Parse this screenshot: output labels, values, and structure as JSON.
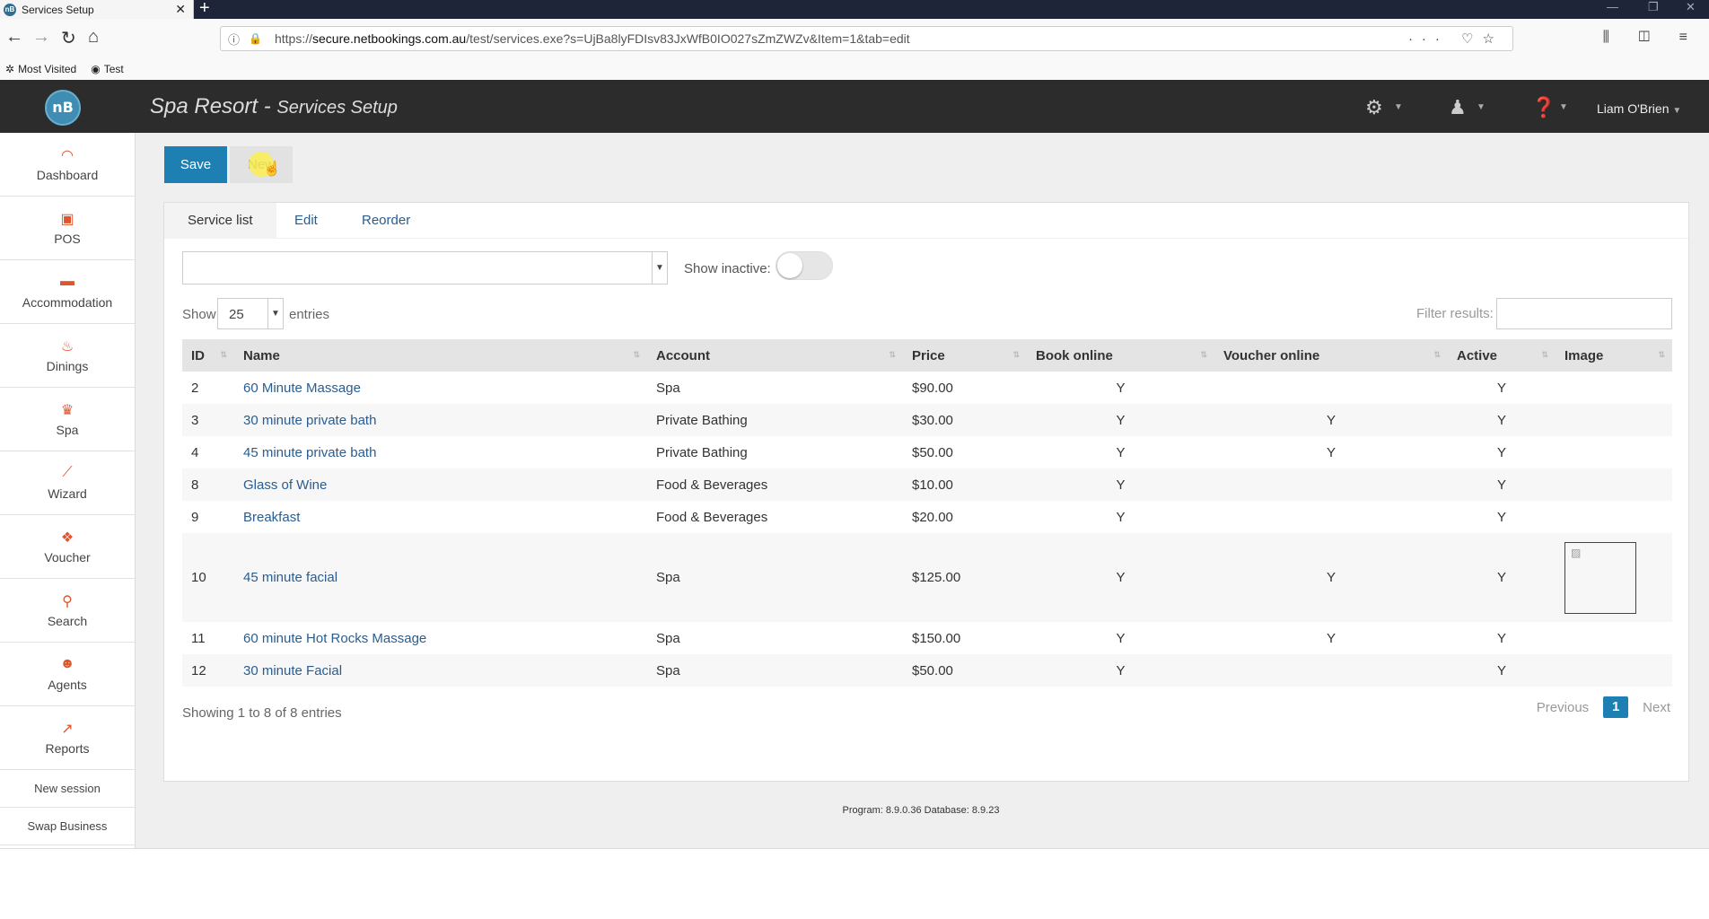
{
  "browser": {
    "tab_title": "Services Setup",
    "tab_favicon": "nB",
    "url_host": "secure.netbookings.com.au",
    "url_prefix": "https://",
    "url_path": "/test/services.exe?s=UjBa8lyFDIsv83JxWfB0IO027sZmZWZv&Item=1&tab=edit",
    "bookmarks": [
      {
        "label": "Most Visited",
        "icon": "gear-icon"
      },
      {
        "label": "Test",
        "icon": "nb-favicon"
      }
    ]
  },
  "app": {
    "logo_text": "nB",
    "title": "Spa Resort",
    "subtitle": "Services Setup",
    "user": "Liam O'Brien",
    "header_icons": [
      "settings-icon",
      "agent-icon",
      "help-icon"
    ]
  },
  "sidebar": {
    "items": [
      {
        "label": "Dashboard",
        "icon": "dashboard-icon"
      },
      {
        "label": "POS",
        "icon": "pos-icon"
      },
      {
        "label": "Accommodation",
        "icon": "bed-icon"
      },
      {
        "label": "Dinings",
        "icon": "dining-icon"
      },
      {
        "label": "Spa",
        "icon": "spa-icon"
      },
      {
        "label": "Wizard",
        "icon": "wand-icon"
      },
      {
        "label": "Voucher",
        "icon": "gift-icon"
      },
      {
        "label": "Search",
        "icon": "search-icon"
      },
      {
        "label": "Agents",
        "icon": "agent-icon"
      },
      {
        "label": "Reports",
        "icon": "chart-icon"
      }
    ],
    "new_session": "New session",
    "swap_business": "Swap Business"
  },
  "toolbar": {
    "save_label": "Save",
    "new_label": "New"
  },
  "tabs": [
    {
      "label": "Service list",
      "active": true
    },
    {
      "label": "Edit",
      "active": false
    },
    {
      "label": "Reorder",
      "active": false
    }
  ],
  "filters": {
    "account_select_value": "",
    "show_inactive_label": "Show inactive:",
    "show_inactive_on": false,
    "show_label": "Show",
    "page_length": "25",
    "entries_label": "entries",
    "filter_label": "Filter results:",
    "filter_value": ""
  },
  "table": {
    "columns": [
      "ID",
      "Name",
      "Account",
      "Price",
      "Book online",
      "Voucher online",
      "Active",
      "Image"
    ],
    "rows": [
      {
        "id": "2",
        "name": "60 Minute Massage",
        "account": "Spa",
        "price": "$90.00",
        "book": "Y",
        "voucher": "",
        "active": "Y",
        "image": false
      },
      {
        "id": "3",
        "name": "30 minute private bath",
        "account": "Private Bathing",
        "price": "$30.00",
        "book": "Y",
        "voucher": "Y",
        "active": "Y",
        "image": false
      },
      {
        "id": "4",
        "name": "45 minute private bath",
        "account": "Private Bathing",
        "price": "$50.00",
        "book": "Y",
        "voucher": "Y",
        "active": "Y",
        "image": false
      },
      {
        "id": "8",
        "name": "Glass of Wine",
        "account": "Food & Beverages",
        "price": "$10.00",
        "book": "Y",
        "voucher": "",
        "active": "Y",
        "image": false
      },
      {
        "id": "9",
        "name": "Breakfast",
        "account": "Food & Beverages",
        "price": "$20.00",
        "book": "Y",
        "voucher": "",
        "active": "Y",
        "image": false
      },
      {
        "id": "10",
        "name": "45 minute facial",
        "account": "Spa",
        "price": "$125.00",
        "book": "Y",
        "voucher": "Y",
        "active": "Y",
        "image": true
      },
      {
        "id": "11",
        "name": "60 minute Hot Rocks Massage",
        "account": "Spa",
        "price": "$150.00",
        "book": "Y",
        "voucher": "Y",
        "active": "Y",
        "image": false
      },
      {
        "id": "12",
        "name": "30 minute Facial",
        "account": "Spa",
        "price": "$50.00",
        "book": "Y",
        "voucher": "",
        "active": "Y",
        "image": false
      }
    ]
  },
  "pagination": {
    "info": "Showing 1 to 8 of 8 entries",
    "previous": "Previous",
    "current": "1",
    "next": "Next"
  },
  "footer": {
    "version": "Program: 8.9.0.36 Database: 8.9.23"
  },
  "colors": {
    "accent": "#1e7fb3",
    "header_bg": "#2c2c2c",
    "sidebar_icon": "#e0542c",
    "link": "#2a5d8f"
  }
}
